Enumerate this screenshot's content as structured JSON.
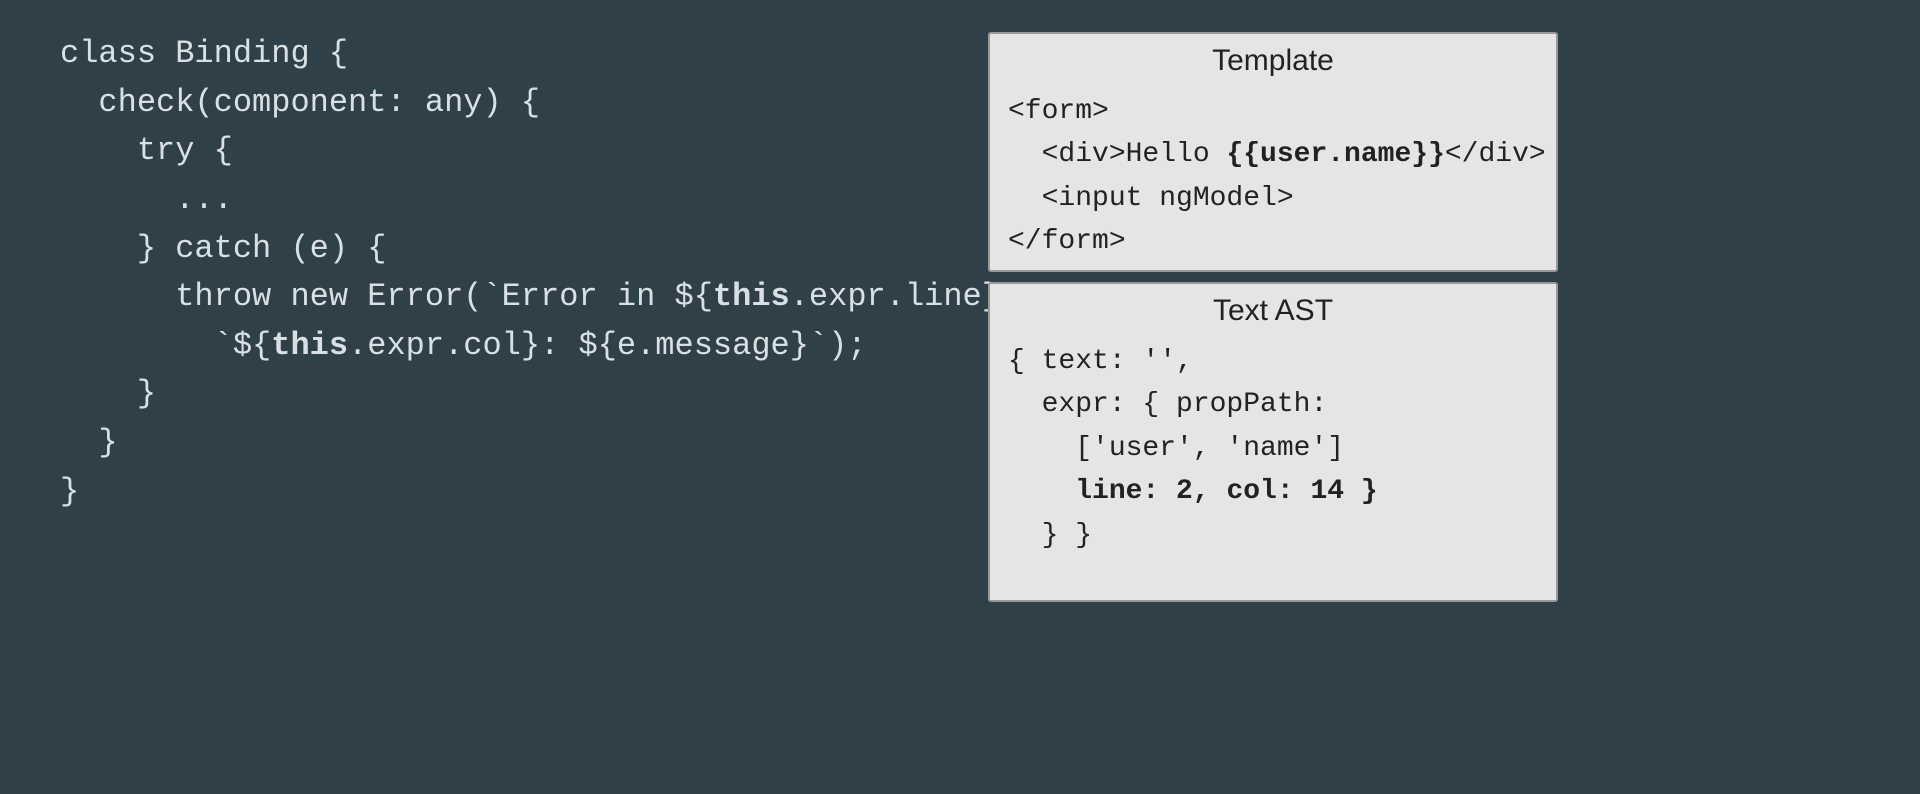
{
  "code": {
    "l1": "class Binding {",
    "l2": "  check(component: any) {",
    "l3": "    try {",
    "l4": "      ...",
    "l5": "    } catch (e) {",
    "l6a": "      throw new Error(`Error in ${",
    "l6b": "this",
    "l6c": ".expr.line}:`+",
    "l7a": "        `${",
    "l7b": "this",
    "l7c": ".expr.col}: ${e.message}`);",
    "l8": "    }",
    "l9": "  }",
    "l10": "}"
  },
  "templatePanel": {
    "title": "Template",
    "l1": "<form>",
    "l2a": "  <div>Hello ",
    "l2b": "{{user.name}}",
    "l2c": "</div>",
    "l3": "  <input ngModel>",
    "l4": "</form>"
  },
  "astPanel": {
    "title": "Text AST",
    "l1": "{ text: '',",
    "l2": "  expr: { propPath:",
    "l3": "    ['user', 'name']",
    "l4a": "    ",
    "l4b": "line: 2, col: 14 }",
    "l5": "  } }"
  }
}
